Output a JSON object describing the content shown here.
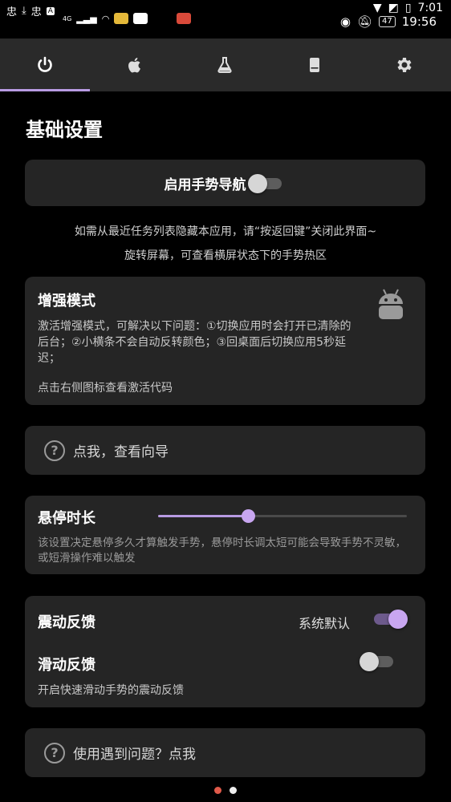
{
  "status_bar": {
    "time_top": "7:01",
    "time_main": "19:56",
    "battery": "47",
    "network": "4G",
    "notification_badge": "A"
  },
  "tabs": [
    {
      "icon": "power-icon",
      "selected": true
    },
    {
      "icon": "apple-icon",
      "selected": false
    },
    {
      "icon": "flask-icon",
      "selected": false
    },
    {
      "icon": "phone-icon",
      "selected": false
    },
    {
      "icon": "gear-icon",
      "selected": false
    }
  ],
  "page_title": "基础设置",
  "gesture_nav": {
    "label": "启用手势导航",
    "enabled": false
  },
  "hints": [
    "如需从最近任务列表隐藏本应用，请“按返回键”关闭此界面~",
    "旋转屏幕，可查看横屏状态下的手势热区"
  ],
  "enhanced_mode": {
    "title": "增强模式",
    "description": "激活增强模式，可解决以下问题：①切换应用时会打开已清除的后台；②小横条不会自动反转颜色；③回桌面后切换应用5秒延迟；",
    "footer": "点击右侧图标查看激活代码"
  },
  "guide": {
    "label": "点我，查看向导"
  },
  "hover": {
    "label": "悬停时长",
    "value": 0.36,
    "description": "该设置决定悬停多久才算触发手势，悬停时长调太短可能会导致手势不灵敏，或短滑操作难以触发"
  },
  "vibration": {
    "label": "震动反馈",
    "mode": "系统默认",
    "enabled": true
  },
  "swipe_vibration": {
    "label": "滑动反馈",
    "enabled": false,
    "description": "开启快速滑动手势的震动反馈"
  },
  "problem": {
    "label": "使用遇到问题？点我"
  },
  "colors": {
    "accent": "#b89be3",
    "card": "#252525",
    "tabbar": "#2a2a2a",
    "page_dot_active": "#e05a4a"
  },
  "pagination": {
    "count": 2,
    "active": 0
  }
}
